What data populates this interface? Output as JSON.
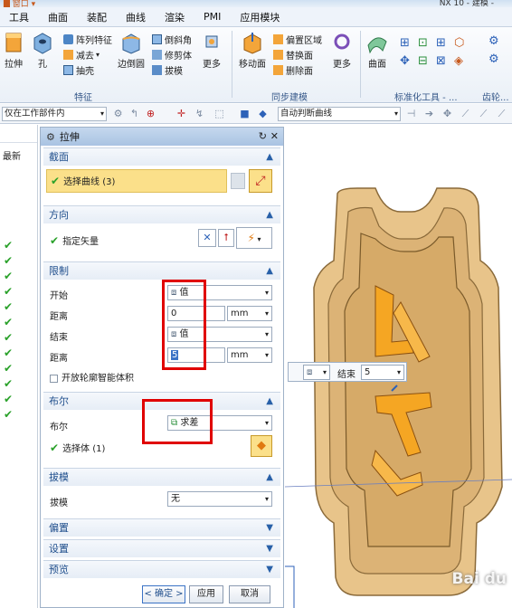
{
  "window": {
    "title": "NX 10 - 建模 -",
    "quick_access": "█ 窗口 ▾"
  },
  "menu": [
    "工具",
    "曲面",
    "装配",
    "曲线",
    "渲染",
    "PMI",
    "应用模块"
  ],
  "ribbon": {
    "feature": {
      "extrude": "拉伸",
      "hole": "孔",
      "pattern": "阵列特征",
      "subtract": "减去",
      "shell": "抽壳",
      "edge_blend": "边倒圆",
      "chamfer": "倒斜角",
      "trim_body": "修剪体",
      "draft": "拔模",
      "more": "更多",
      "group_label": "特征"
    },
    "sync": {
      "move_face": "移动面",
      "offset_region": "偏置区域",
      "replace_face": "替换面",
      "delete_face": "删除面",
      "more": "更多",
      "group_label": "同步建模"
    },
    "surface": {
      "surface": "曲面",
      "group_label": "标准化工具 - ...",
      "group_label2": "齿轮..."
    }
  },
  "toolbar": {
    "selection_filter": "仅在工作部件内",
    "curve_rule": "自动判断曲线"
  },
  "navigator": {
    "header": "最新",
    "check_count": 12
  },
  "dialog": {
    "title": "拉伸",
    "section": {
      "label": "截面",
      "select_curve": "选择曲线 (3)"
    },
    "direction": {
      "label": "方向",
      "specify_vector": "指定矢量"
    },
    "limits": {
      "label": "限制",
      "start_label": "开始",
      "start_value": "值",
      "distance1_label": "距离",
      "distance1_value": "0",
      "distance1_unit": "mm",
      "end_label": "结束",
      "end_value": "值",
      "distance2_label": "距离",
      "distance2_value": "5",
      "distance2_unit": "mm",
      "open_profile": "开放轮廓智能体积"
    },
    "boolean": {
      "label": "布尔",
      "boolean_label": "布尔",
      "boolean_value": "求差",
      "select_body": "选择体 (1)"
    },
    "draft": {
      "label": "拔模",
      "draft_label": "拔模",
      "draft_value": "无"
    },
    "offset": {
      "label": "偏置"
    },
    "settings": {
      "label": "设置"
    },
    "preview": {
      "label": "预览"
    },
    "buttons": {
      "ok": "< 确定 >",
      "apply": "应用",
      "cancel": "取消"
    }
  },
  "viewport_popup": {
    "label": "结束",
    "value": "5"
  },
  "watermark": "Bai du"
}
